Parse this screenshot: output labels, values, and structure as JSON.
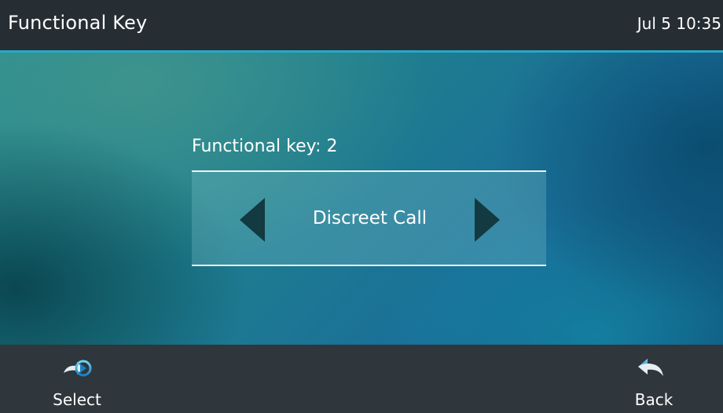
{
  "header": {
    "title": "Functional Key",
    "clock": "Jul 5 10:35"
  },
  "main": {
    "field_label": "Functional key: 2",
    "selected_value": "Discreet Call"
  },
  "softkeys": {
    "select_label": "Select",
    "back_label": "Back"
  },
  "colors": {
    "accent": "#2aa7c7",
    "status_bar": "#262d33",
    "softkey_bar": "#2f363c",
    "arrow": "#123a40"
  },
  "icons": {
    "select": "select-arrow-icon",
    "back": "back-arrow-icon",
    "prev": "left-triangle-icon",
    "next": "right-triangle-icon"
  }
}
